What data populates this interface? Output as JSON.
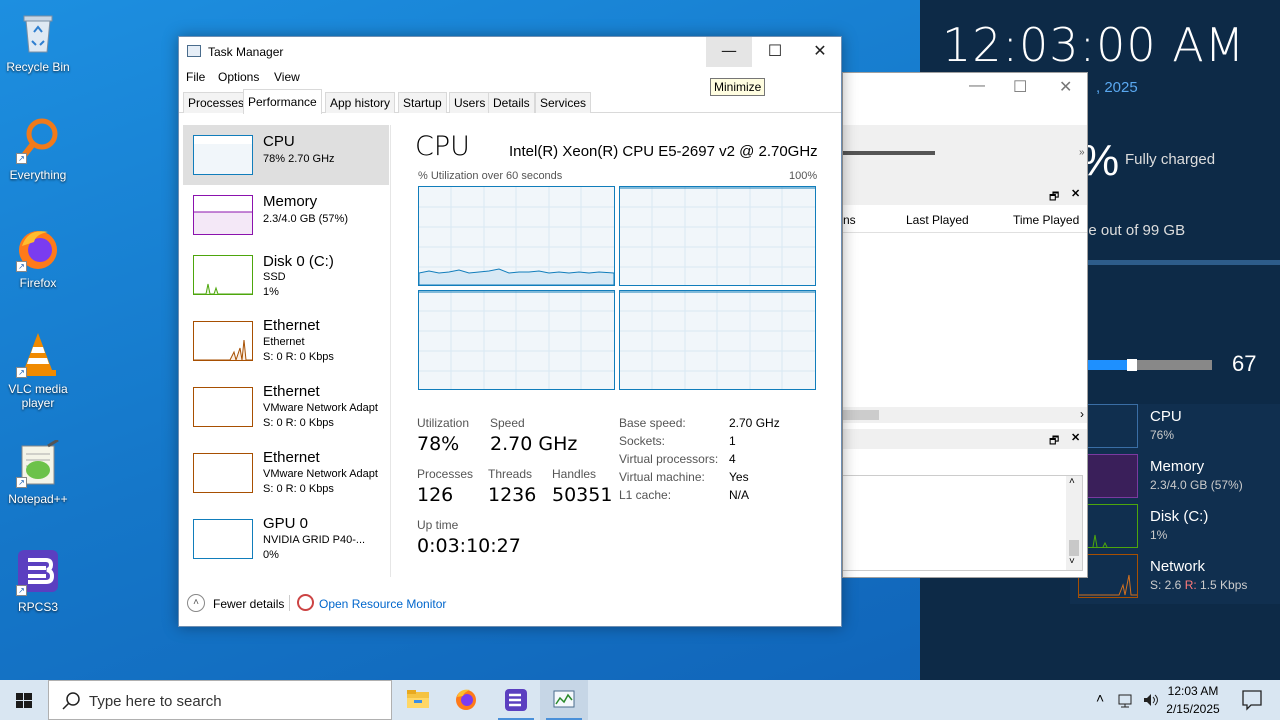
{
  "desktop": {
    "icons": [
      {
        "label": "Recycle Bin"
      },
      {
        "label": "Everything"
      },
      {
        "label": "Firefox"
      },
      {
        "label": "VLC media player"
      },
      {
        "label": "Notepad++"
      },
      {
        "label": "RPCS3"
      }
    ]
  },
  "widget": {
    "clock": "12:03:00 AM",
    "date_partial": ", 2025",
    "battery_pct": "%",
    "battery_status": "Fully charged",
    "disk_free": "ee out of 99 GB",
    "volume": "67",
    "volume_level": 0.35,
    "perf": [
      {
        "name": "CPU",
        "value": "76%"
      },
      {
        "name": "Memory",
        "value": "2.3/4.0 GB (57%)"
      },
      {
        "name": "Disk (C:)",
        "value": "1%"
      },
      {
        "name": "Network",
        "value_prefix": "S: 2.6 ",
        "value_r": "R:",
        "value_suffix": " 1.5 Kbps"
      }
    ]
  },
  "bgwindow": {
    "col_partial": "ns",
    "col_last_played": "Last Played",
    "col_time_played": "Time Played"
  },
  "taskmanager": {
    "title": "Task Manager",
    "tooltip": "Minimize",
    "menu": [
      "File",
      "Options",
      "View"
    ],
    "tabs": [
      "Processes",
      "Performance",
      "App history",
      "Startup",
      "Users",
      "Details",
      "Services"
    ],
    "active_tab": "Performance",
    "sidebar": [
      {
        "name": "CPU",
        "sub1": "78% 2.70 GHz",
        "sub2": "",
        "sub3": "",
        "color": "#117dbb"
      },
      {
        "name": "Memory",
        "sub1": "2.3/4.0 GB (57%)",
        "sub2": "",
        "sub3": "",
        "color": "#8b12ae"
      },
      {
        "name": "Disk 0 (C:)",
        "sub1": "SSD",
        "sub2": "1%",
        "sub3": "",
        "color": "#4da60c"
      },
      {
        "name": "Ethernet",
        "sub1": "Ethernet",
        "sub2": "S: 0 R: 0 Kbps",
        "sub3": "",
        "color": "#a74f01"
      },
      {
        "name": "Ethernet",
        "sub1": "VMware Network Adapt",
        "sub2": "S: 0 R: 0 Kbps",
        "sub3": "",
        "color": "#a74f01"
      },
      {
        "name": "Ethernet",
        "sub1": "VMware Network Adapt",
        "sub2": "S: 0 R: 0 Kbps",
        "sub3": "",
        "color": "#a74f01"
      },
      {
        "name": "GPU 0",
        "sub1": "NVIDIA GRID P40-...",
        "sub2": "0%",
        "sub3": "",
        "color": "#117dbb"
      }
    ],
    "cpu": {
      "heading": "CPU",
      "model": "Intel(R) Xeon(R) CPU E5-2697 v2 @ 2.70GHz",
      "util_label": "% Utilization over 60 seconds",
      "util_max": "100%",
      "stats": {
        "utilization_label": "Utilization",
        "utilization": "78%",
        "speed_label": "Speed",
        "speed": "2.70 GHz",
        "processes_label": "Processes",
        "processes": "126",
        "threads_label": "Threads",
        "threads": "1236",
        "handles_label": "Handles",
        "handles": "50351",
        "uptime_label": "Up time",
        "uptime": "0:03:10:27"
      },
      "details": [
        {
          "label": "Base speed:",
          "value": "2.70 GHz"
        },
        {
          "label": "Sockets:",
          "value": "1"
        },
        {
          "label": "Virtual processors:",
          "value": "4"
        },
        {
          "label": "Virtual machine:",
          "value": "Yes"
        },
        {
          "label": "L1 cache:",
          "value": "N/A"
        }
      ]
    },
    "footer": {
      "fewer": "Fewer details",
      "resource_monitor": "Open Resource Monitor"
    }
  },
  "taskbar": {
    "search_placeholder": "Type here to search",
    "time": "12:03 AM",
    "date": "2/15/2025"
  }
}
